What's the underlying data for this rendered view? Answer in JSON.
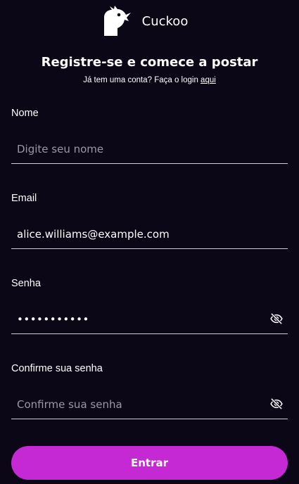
{
  "brand": {
    "name": "Cuckoo",
    "logo_icon": "cuckoo-bird-logo-icon"
  },
  "header": {
    "title": "Registre-se e comece a postar",
    "subtitle_prefix": "Já tem uma conta? Faça o login ",
    "login_link": "aqui"
  },
  "form": {
    "name": {
      "label": "Nome",
      "value": "",
      "placeholder": "Digite seu nome"
    },
    "email": {
      "label": "Email",
      "value": "alice.williams@example.com",
      "placeholder": ""
    },
    "password": {
      "label": "Senha",
      "value": "•••••••••••",
      "placeholder": "",
      "toggle_icon": "eye-off-icon"
    },
    "confirm": {
      "label": "Confirme sua senha",
      "value": "",
      "placeholder": "Confirme sua senha",
      "toggle_icon": "eye-off-icon"
    },
    "submit_label": "Entrar"
  },
  "colors": {
    "background": "#0b0717",
    "accent": "#c429d4",
    "text": "#ffffff",
    "placeholder": "#9a98a6",
    "underline": "#cfcdd6"
  }
}
